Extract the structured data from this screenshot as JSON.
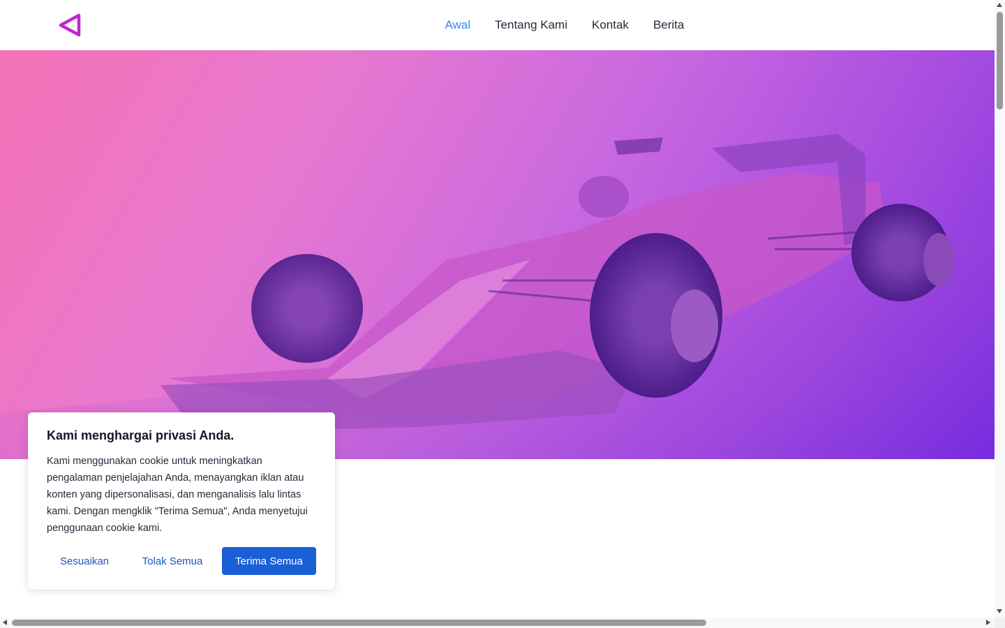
{
  "header": {
    "logo_icon": "play-back-triangle-icon",
    "brand_color": "#c026d3",
    "nav": [
      {
        "label": "Awal",
        "active": true
      },
      {
        "label": "Tentang Kami",
        "active": false
      },
      {
        "label": "Kontak",
        "active": false
      },
      {
        "label": "Berita",
        "active": false
      }
    ],
    "active_color": "#3b82f6"
  },
  "hero": {
    "image": "formula-one-race-car-photo",
    "overlay_gradient": [
      "#f472b6",
      "#c868e0",
      "#7c2ee0"
    ]
  },
  "cookie_banner": {
    "title": "Kami menghargai privasi Anda.",
    "text": "Kami menggunakan cookie untuk meningkatkan pengalaman penjelajahan Anda, menayangkan iklan atau konten yang dipersonalisasi, dan menganalisis lalu lintas kami. Dengan mengklik \"Terima Semua\", Anda menyetujui penggunaan cookie kami.",
    "customize_label": "Sesuaikan",
    "reject_label": "Tolak Semua",
    "accept_label": "Terima Semua",
    "button_color": "#1a5fd6"
  }
}
